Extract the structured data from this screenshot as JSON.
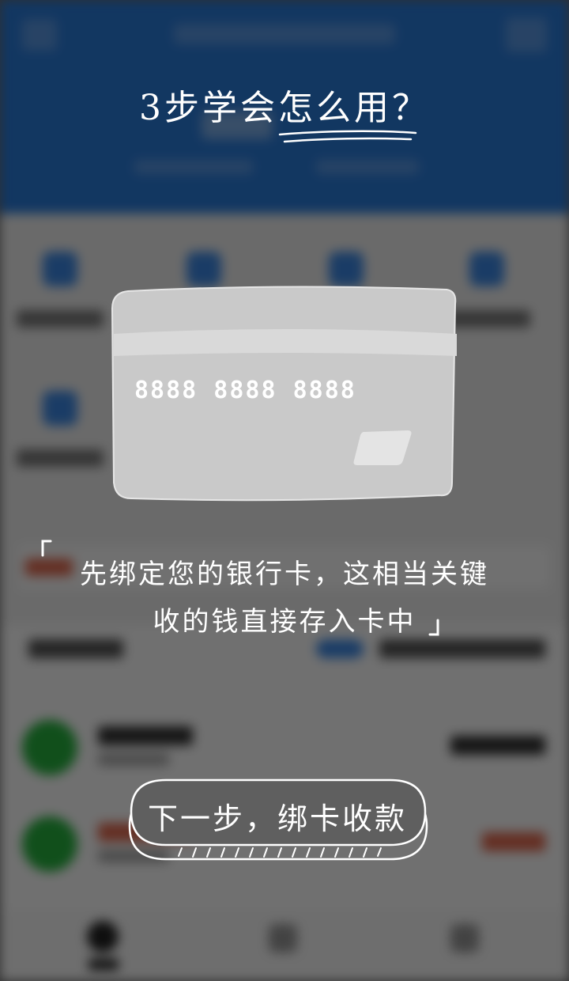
{
  "guide": {
    "title": "3步学会怎么用？",
    "card_number": "8888 8888 8888",
    "description_line1": "先绑定您的银行卡，这相当关键",
    "description_line2": "收的钱直接存入卡中",
    "next_button_label": "下一步，绑卡收款"
  },
  "colors": {
    "overlay": "#000000",
    "text": "#ffffff",
    "card": "#c8c8c8",
    "background_header": "#2a7dde"
  },
  "icons": {
    "card": "bank-card-icon",
    "chip": "card-chip-icon",
    "quote_open": "quote-open-icon",
    "quote_close": "quote-close-icon"
  }
}
